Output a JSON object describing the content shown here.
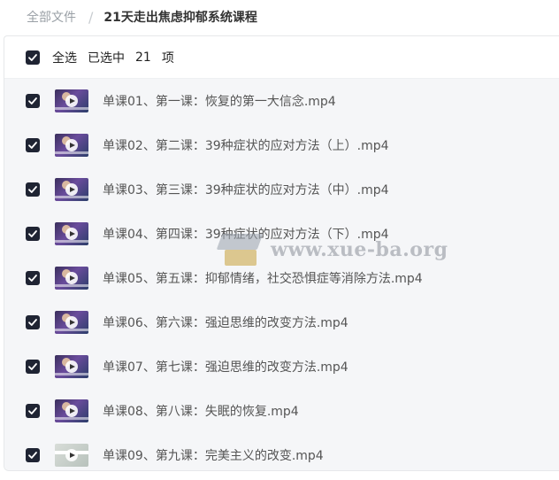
{
  "breadcrumb": {
    "root": "全部文件",
    "separator": "/",
    "current": "21天走出焦虑抑郁系统课程"
  },
  "selection": {
    "select_all_label": "全选",
    "selected_label": "已选中",
    "count": "21",
    "unit": "项"
  },
  "files": [
    {
      "name": "单课01、第一课：恢复的第一大信念.mp4",
      "checked": true
    },
    {
      "name": "单课02、第二课：39种症状的应对方法（上）.mp4",
      "checked": true
    },
    {
      "name": "单课03、第三课：39种症状的应对方法（中）.mp4",
      "checked": true
    },
    {
      "name": "单课04、第四课：39种症状的应对方法（下）.mp4",
      "checked": true
    },
    {
      "name": "单课05、第五课：抑郁情绪，社交恐惧症等消除方法.mp4",
      "checked": true
    },
    {
      "name": "单课06、第六课：强迫思维的改变方法.mp4",
      "checked": true
    },
    {
      "name": "单课07、第七课：强迫思维的改变方法.mp4",
      "checked": true
    },
    {
      "name": "单课08、第八课：失眠的恢复.mp4",
      "checked": true
    },
    {
      "name": "单课09、第九课：完美主义的改变.mp4",
      "checked": true
    }
  ],
  "watermark": {
    "text": "www.xue-ba.org"
  },
  "colors": {
    "checkbox": "#1f2433",
    "list_background": "#f5f6f8",
    "text_muted": "#9aa0a6"
  }
}
